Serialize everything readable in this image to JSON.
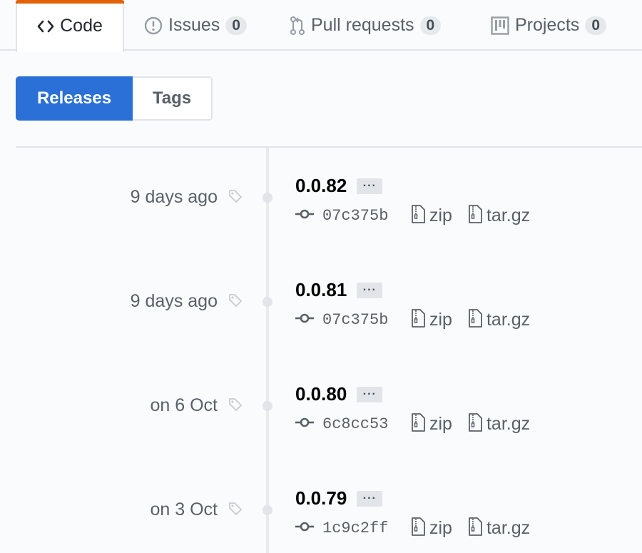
{
  "reponav": {
    "tabs": [
      {
        "label": "Code",
        "icon": "code-icon",
        "selected": true
      },
      {
        "label": "Issues",
        "icon": "issue-opened-icon",
        "count": "0"
      },
      {
        "label": "Pull requests",
        "icon": "git-pull-request-icon",
        "count": "0"
      },
      {
        "label": "Projects",
        "icon": "project-icon",
        "count": "0"
      }
    ]
  },
  "subnav": {
    "releases_label": "Releases",
    "tags_label": "Tags",
    "selected": "Releases"
  },
  "colors": {
    "accent": "#2a70d6",
    "tab_highlight": "#e36209",
    "muted_text": "#586069",
    "border": "#e1e4e8"
  },
  "releases": [
    {
      "date": "9 days ago",
      "version": "0.0.82",
      "more": "···",
      "commit": "07c375b",
      "zip": "zip",
      "tar": "tar.gz"
    },
    {
      "date": "9 days ago",
      "version": "0.0.81",
      "more": "···",
      "commit": "07c375b",
      "zip": "zip",
      "tar": "tar.gz"
    },
    {
      "date": "on 6 Oct",
      "version": "0.0.80",
      "more": "···",
      "commit": "6c8cc53",
      "zip": "zip",
      "tar": "tar.gz"
    },
    {
      "date": "on 3 Oct",
      "version": "0.0.79",
      "more": "···",
      "commit": "1c9c2ff",
      "zip": "zip",
      "tar": "tar.gz"
    }
  ]
}
